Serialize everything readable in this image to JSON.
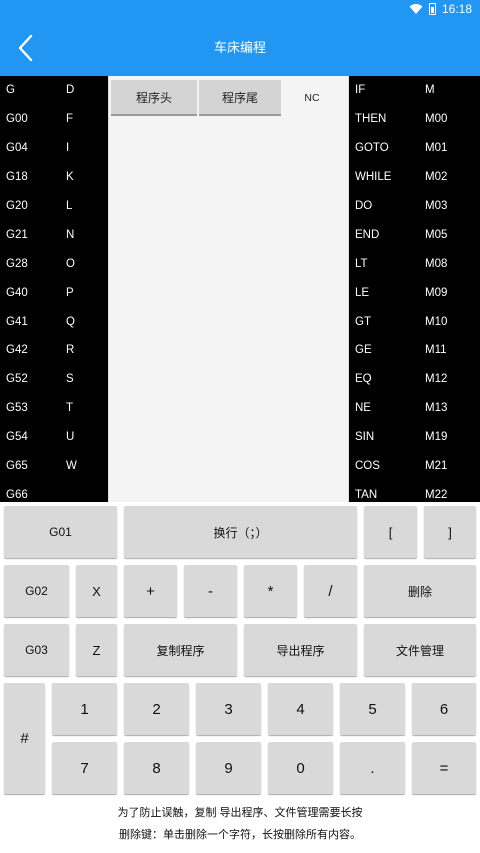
{
  "status_bar": {
    "time": "16:18"
  },
  "app_bar": {
    "title": "车床编程"
  },
  "left_keywords": [
    [
      "G",
      "D"
    ],
    [
      "G00",
      "F"
    ],
    [
      "G04",
      "I"
    ],
    [
      "G18",
      "K"
    ],
    [
      "G20",
      "L"
    ],
    [
      "G21",
      "N"
    ],
    [
      "G28",
      "O"
    ],
    [
      "G40",
      "P"
    ],
    [
      "G41",
      "Q"
    ],
    [
      "G42",
      "R"
    ],
    [
      "G52",
      "S"
    ],
    [
      "G53",
      "T"
    ],
    [
      "G54",
      "U"
    ],
    [
      "G65",
      "W"
    ],
    [
      "G66",
      ""
    ]
  ],
  "right_keywords": [
    [
      "IF",
      "M"
    ],
    [
      " THEN",
      "M00"
    ],
    [
      "GOTO",
      "M01"
    ],
    [
      "WHILE",
      "M02"
    ],
    [
      " DO",
      "M03"
    ],
    [
      "END",
      "M05"
    ],
    [
      " LT",
      "M08"
    ],
    [
      " LE",
      "M09"
    ],
    [
      " GT",
      "M10"
    ],
    [
      " GE",
      "M11"
    ],
    [
      " EQ",
      "M12"
    ],
    [
      " NE",
      "M13"
    ],
    [
      "SIN",
      "M19"
    ],
    [
      "COS",
      "M21"
    ],
    [
      "TAN",
      "M22"
    ]
  ],
  "editor": {
    "tabs": [
      "程序头",
      "程序尾",
      "NC"
    ]
  },
  "keys": {
    "g01": "G01",
    "newline": "换行（；）",
    "lbracket": "[",
    "rbracket": "]",
    "g02": "G02",
    "x": "X",
    "plus": "+",
    "minus": "-",
    "multiply": "*",
    "divide": "/",
    "delete": "删除",
    "g03": "G03",
    "z": "Z",
    "copy": "复制程序",
    "export": "导出程序",
    "files": "文件管理",
    "hash": "#",
    "d1": "1",
    "d2": "2",
    "d3": "3",
    "d4": "4",
    "d5": "5",
    "d6": "6",
    "d7": "7",
    "d8": "8",
    "d9": "9",
    "d0": "0",
    "dot": ".",
    "equals": "="
  },
  "footer": {
    "line1": "为了防止误触，复制 导出程序、文件管理需要长按",
    "line2": "删除键：单击删除一个字符，长按删除所有内容。"
  },
  "colors": {
    "accent": "#2196f3",
    "panel": "#000000",
    "key": "#d9d9d9"
  }
}
